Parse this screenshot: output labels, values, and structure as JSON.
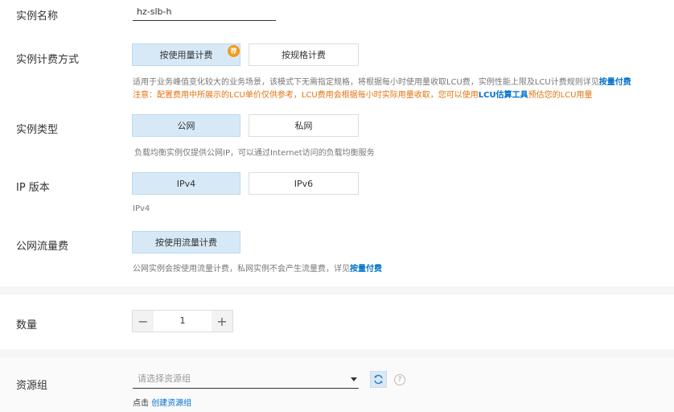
{
  "instance_name": {
    "label": "实例名称",
    "value": "hz-slb-h"
  },
  "billing": {
    "label": "实例计费方式",
    "options": [
      "按使用量计费",
      "按规格计费"
    ],
    "badge": "荐",
    "hint_text": "适用于业务峰值变化较大的业务场景，该模式下无需指定规格，将根据每小时使用量收取LCU费，实例性能上限及LCU计费规则详见",
    "hint_link": "按量付费",
    "warn_a": "注意：配置费用中所展示的LCU单价仅供参考，LCU费用会根据每小时实际用量收取，您可以使用",
    "warn_link": "LCU估算工具",
    "warn_b": "预估您的LCU用量"
  },
  "instance_type": {
    "label": "实例类型",
    "options": [
      "公网",
      "私网"
    ],
    "hint": "负载均衡实例仅提供公网IP，可以通过Internet访问的负载均衡服务"
  },
  "ip_version": {
    "label": "IP 版本",
    "options": [
      "IPv4",
      "IPv6"
    ],
    "hint": "IPv4"
  },
  "traffic": {
    "label": "公网流量费",
    "option": "按使用流量计费",
    "hint_text": "公网实例会按使用流量计费，私网实例不会产生流量费，详见",
    "hint_link": "按量付费"
  },
  "quantity": {
    "label": "数量",
    "value": "1",
    "minus": "−",
    "plus": "+"
  },
  "resource_group": {
    "label": "资源组",
    "placeholder": "请选择资源组",
    "help": "?",
    "create_prefix": "点击",
    "create_link": "创建资源组"
  },
  "colors": {
    "selected_bg": "#d7e9f7",
    "link": "#0070cc",
    "warning": "#e3730e",
    "badge": "#f29a1d"
  }
}
